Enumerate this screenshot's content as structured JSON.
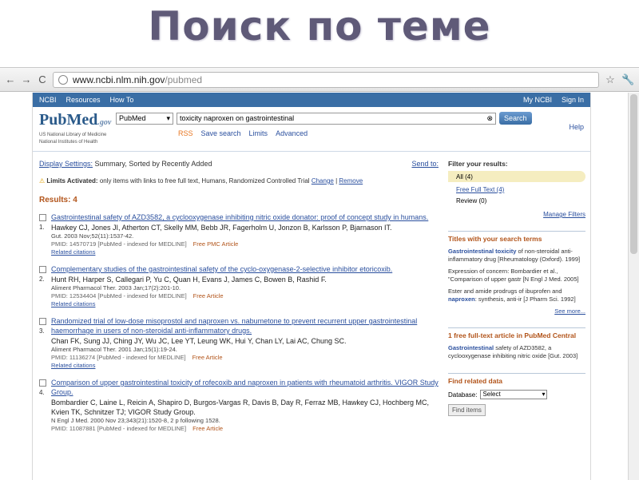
{
  "slide": {
    "title": "Поиск по теме"
  },
  "browser": {
    "back": "←",
    "forward": "→",
    "reload": "C",
    "url_domain": "www.ncbi.nlm.nih.gov",
    "url_path": "/pubmed",
    "star": "☆",
    "wrench": "🔧"
  },
  "ncbi": {
    "logo": "NCBI",
    "resources": "Resources",
    "howto": "How To",
    "myncbi": "My NCBI",
    "signin": "Sign In"
  },
  "pubmed": {
    "logo": "PubMed",
    "logo_sub": ".gov",
    "lib1": "US National Library of Medicine",
    "lib2": "National Institutes of Health",
    "db": "PubMed",
    "query": "toxicity naproxen on gastrointestinal",
    "search": "Search",
    "rss": "RSS",
    "save": "Save search",
    "limits": "Limits",
    "advanced": "Advanced",
    "help": "Help"
  },
  "display": {
    "label": "Display Settings:",
    "value": "Summary, Sorted by Recently Added",
    "sendto": "Send to:"
  },
  "limits": {
    "label": "Limits Activated:",
    "text": "only items with links to free full text, Humans, Randomized Controlled Trial",
    "change": "Change",
    "remove": "Remove"
  },
  "results_count": "Results: 4",
  "results": [
    {
      "num": "1.",
      "title": "Gastrointestinal safety of AZD3582, a cyclooxygenase inhibiting nitric oxide donator: proof of concept study in humans.",
      "authors": "Hawkey CJ, Jones JI, Atherton CT, Skelly MM, Bebb JR, Fagerholm U, Jonzon B, Karlsson P, Bjarnason IT.",
      "source": "Gut. 2003 Nov;52(11):1537-42.",
      "pmid": "PMID: 14570719 [PubMed - indexed for MEDLINE]",
      "free": "Free PMC Article",
      "rel": "Related citations"
    },
    {
      "num": "2.",
      "title": "Complementary studies of the gastrointestinal safety of the cyclo-oxygenase-2-selective inhibitor etoricoxib.",
      "authors": "Hunt RH, Harper S, Callegari P, Yu C, Quan H, Evans J, James C, Bowen B, Rashid F.",
      "source": "Aliment Pharmacol Ther. 2003 Jan;17(2):201-10.",
      "pmid": "PMID: 12534404 [PubMed - indexed for MEDLINE]",
      "free": "Free Article",
      "rel": "Related citations"
    },
    {
      "num": "3.",
      "title": "Randomized trial of low-dose misoprostol and naproxen vs. nabumetone to prevent recurrent upper gastrointestinal haemorrhage in users of non-steroidal anti-inflammatory drugs.",
      "authors": "Chan FK, Sung JJ, Ching JY, Wu JC, Lee YT, Leung WK, Hui Y, Chan LY, Lai AC, Chung SC.",
      "source": "Aliment Pharmacol Ther. 2001 Jan;15(1):19-24.",
      "pmid": "PMID: 11136274 [PubMed - indexed for MEDLINE]",
      "free": "Free Article",
      "rel": "Related citations"
    },
    {
      "num": "4.",
      "title": "Comparison of upper gastrointestinal toxicity of rofecoxib and naproxen in patients with rheumatoid arthritis. VIGOR Study Group.",
      "authors": "Bombardier C, Laine L, Reicin A, Shapiro D, Burgos-Vargas R, Davis B, Day R, Ferraz MB, Hawkey CJ, Hochberg MC, Kvien TK, Schnitzer TJ; VIGOR Study Group.",
      "source": "N Engl J Med. 2000 Nov 23;343(21):1520-8, 2 p following 1528.",
      "pmid": "PMID: 11087881 [PubMed - indexed for MEDLINE]",
      "free": "Free Article",
      "rel": ""
    }
  ],
  "filters": {
    "title": "Filter your results:",
    "all": "All (4)",
    "fft": "Free Full Text (4)",
    "review": "Review (0)",
    "manage": "Manage Filters"
  },
  "titles_box": {
    "heading": "Titles with your search terms",
    "e1_link": "Gastrointestinal toxicity",
    "e1_rest": "of non-steroidal anti-inflammatory drug",
    "e1_src": "[Rheumatology (Oxford). 1999]",
    "e2_a": "Expression of concern: Bombardier et al.,",
    "e2_b": "\"Comparison of upper gastr",
    "e2_src": "[N Engl J Med. 2005]",
    "e3_a": "Ester and amide prodrugs of ibuprofen and",
    "e3_b": "naproxen",
    "e3_c": ": synthesis, anti-ir",
    "e3_src": "[J Pharm Sci. 1992]",
    "see_more": "See more..."
  },
  "pmc_box": {
    "heading": "1 free full-text article in PubMed Central",
    "e1_link": "Gastrointestinal",
    "e1_rest": "safety of AZD3582, a cyclooxygenase inhibiting nitric oxide",
    "e1_src": "[Gut. 2003]"
  },
  "related_box": {
    "heading": "Find related data",
    "db_label": "Database:",
    "db_value": "Select",
    "find": "Find items"
  }
}
